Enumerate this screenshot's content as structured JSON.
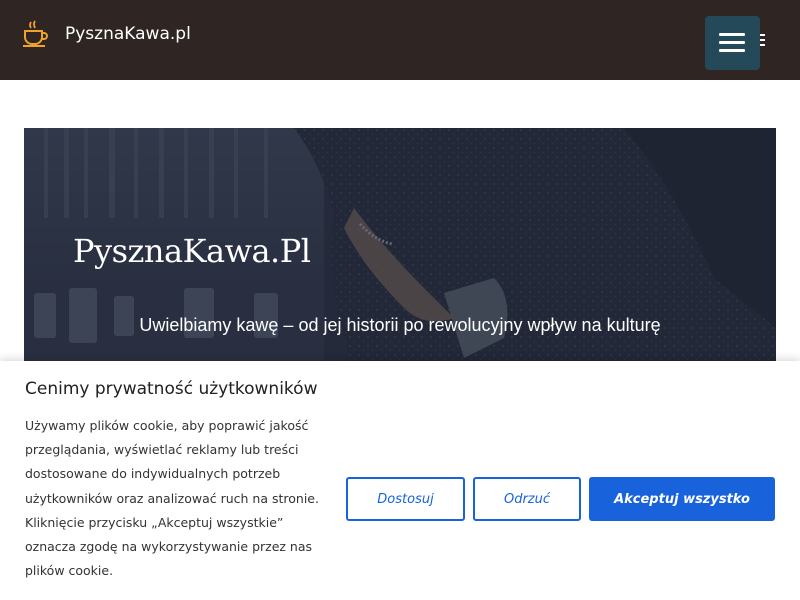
{
  "header": {
    "site_name": "PysznaKawa.pl",
    "logo_icon": "coffee-cup-icon",
    "menu_icon": "hamburger-menu-icon",
    "colors": {
      "background": "#2f2522",
      "menu_button": "#244a5a",
      "logo": "#f0a32b"
    }
  },
  "hero": {
    "title": "PysznaKawa.Pl",
    "subtitle": "Uwielbiamy kawę – od jej historii po rewolucyjny wpływ na kulturę"
  },
  "cookie_banner": {
    "title": "Cenimy prywatność użytkowników",
    "text": "Używamy plików cookie, aby poprawić jakość przeglądania, wyświetlać reklamy lub treści dostosowane do indywidualnych potrzeb użytkowników oraz analizować ruch na stronie. Kliknięcie przycisku „Akceptuj wszystkie” oznacza zgodę na wykorzystywanie przez nas plików cookie.",
    "customize_label": "Dostosuj",
    "reject_label": "Odrzuć",
    "accept_label": "Akceptuj wszystko",
    "colors": {
      "accent": "#1863dc"
    }
  }
}
